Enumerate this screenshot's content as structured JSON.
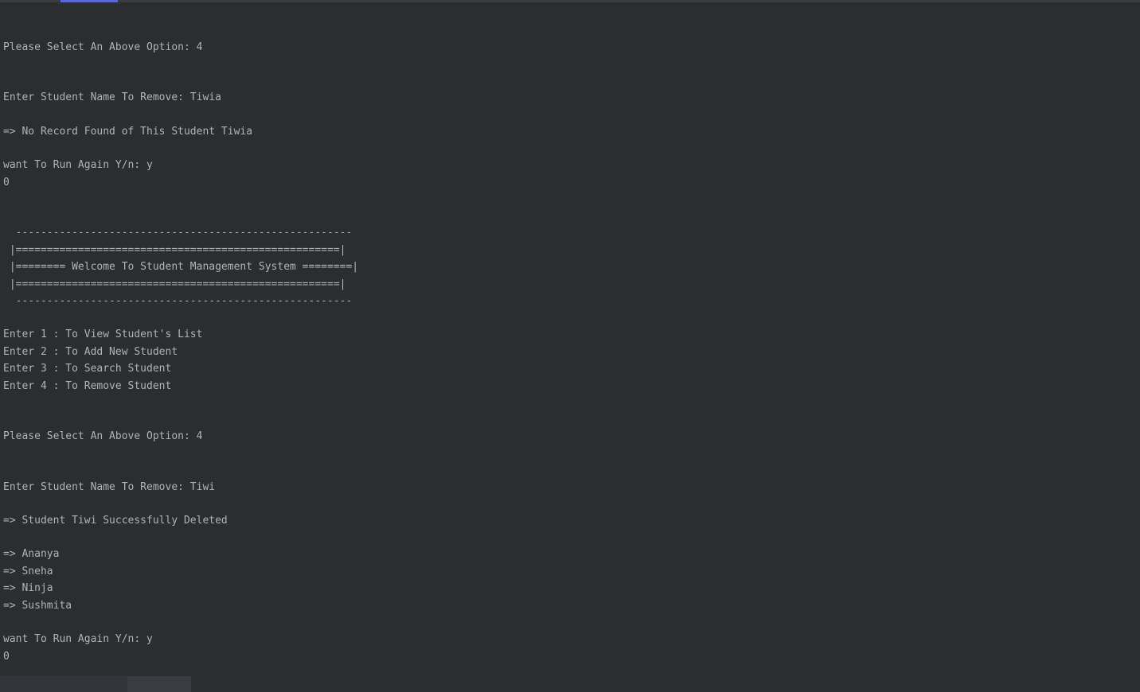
{
  "terminal": {
    "lines": [
      {
        "t": "blank"
      },
      {
        "t": "blank"
      },
      {
        "t": "text",
        "v": "Please Select An Above Option: 4"
      },
      {
        "t": "blank"
      },
      {
        "t": "blank"
      },
      {
        "t": "text",
        "v": "Enter Student Name To Remove: Tiwia"
      },
      {
        "t": "blank"
      },
      {
        "t": "text",
        "v": "=> No Record Found of This Student Tiwia"
      },
      {
        "t": "blank"
      },
      {
        "t": "text",
        "v": "want To Run Again Y/n: y"
      },
      {
        "t": "text",
        "v": "0"
      },
      {
        "t": "blank"
      },
      {
        "t": "blank"
      },
      {
        "t": "text",
        "v": "  ------------------------------------------------------"
      },
      {
        "t": "text",
        "v": " |====================================================|"
      },
      {
        "t": "text",
        "v": " |======== Welcome To Student Management System ========|"
      },
      {
        "t": "text",
        "v": " |====================================================|"
      },
      {
        "t": "text",
        "v": "  ------------------------------------------------------"
      },
      {
        "t": "blank"
      },
      {
        "t": "text",
        "v": "Enter 1 : To View Student's List"
      },
      {
        "t": "text",
        "v": "Enter 2 : To Add New Student"
      },
      {
        "t": "text",
        "v": "Enter 3 : To Search Student"
      },
      {
        "t": "text",
        "v": "Enter 4 : To Remove Student"
      },
      {
        "t": "blank"
      },
      {
        "t": "blank"
      },
      {
        "t": "text",
        "v": "Please Select An Above Option: 4"
      },
      {
        "t": "blank"
      },
      {
        "t": "blank"
      },
      {
        "t": "text",
        "v": "Enter Student Name To Remove: Tiwi"
      },
      {
        "t": "blank"
      },
      {
        "t": "text",
        "v": "=> Student Tiwi Successfully Deleted "
      },
      {
        "t": "blank"
      },
      {
        "t": "text",
        "v": "=> Ananya"
      },
      {
        "t": "text",
        "v": "=> Sneha"
      },
      {
        "t": "text",
        "v": "=> Ninja"
      },
      {
        "t": "text",
        "v": "=> Sushmita"
      },
      {
        "t": "blank"
      },
      {
        "t": "text",
        "v": "want To Run Again Y/n: y"
      },
      {
        "t": "text",
        "v": "0"
      }
    ]
  }
}
